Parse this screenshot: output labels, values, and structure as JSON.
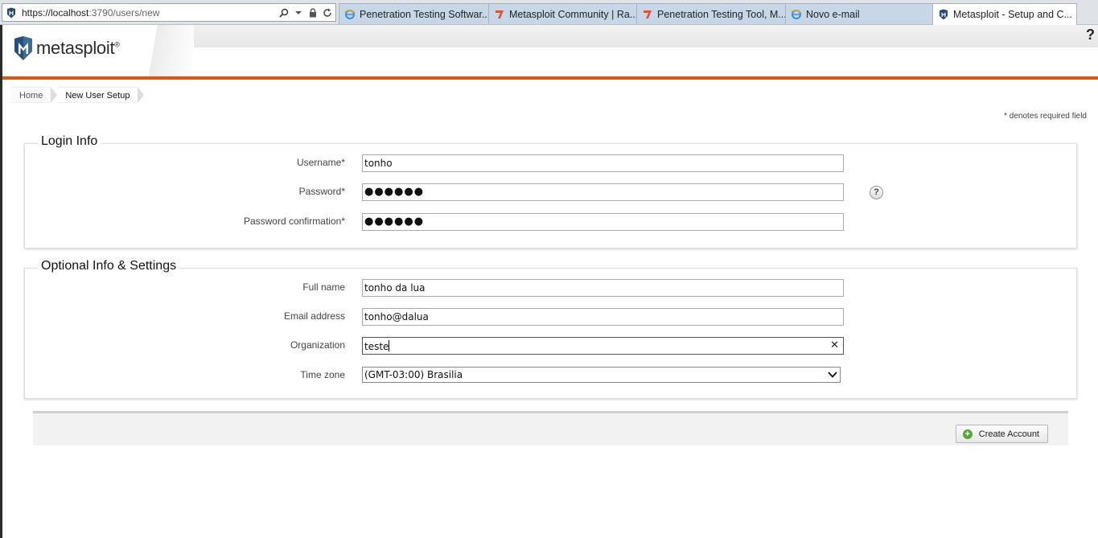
{
  "browser": {
    "url_prefix": "https://localhost",
    "url_rest": ":3790/users/new",
    "tabs": [
      {
        "label": "Penetration Testing Softwar...",
        "icon": "ie-icon",
        "active": false
      },
      {
        "label": "Metasploit Community | Ra...",
        "icon": "rapid7-icon",
        "active": false
      },
      {
        "label": "Penetration Testing Tool, M...",
        "icon": "rapid7-icon",
        "active": false
      },
      {
        "label": "Novo e-mail",
        "icon": "ie-icon",
        "active": false
      },
      {
        "label": "Metasploit - Setup and C...",
        "icon": "metasploit-icon",
        "active": true,
        "close": "×"
      }
    ]
  },
  "header": {
    "logo_text": "metasploit",
    "logo_mark": "®",
    "help": "?"
  },
  "breadcrumb": {
    "home": "Home",
    "current": "New User Setup"
  },
  "required_note": "* denotes required field",
  "login_info": {
    "title": "Login Info",
    "username_label": "Username*",
    "username_value": "tonho",
    "password_label": "Password*",
    "password_value": "●●●●●●",
    "password_help": "?",
    "password_confirm_label": "Password confirmation*",
    "password_confirm_value": "●●●●●●"
  },
  "optional_info": {
    "title": "Optional Info & Settings",
    "fullname_label": "Full name",
    "fullname_value": "tonho da lua",
    "email_label": "Email address",
    "email_value": "tonho@dalua",
    "org_label": "Organization",
    "org_value": "teste",
    "org_clear": "✕",
    "timezone_label": "Time zone",
    "timezone_value": "(GMT-03:00) Brasilia"
  },
  "actions": {
    "create_account": "Create Account"
  },
  "colors": {
    "accent_orange": "#e0560f",
    "tab_bg": "#c7d7e8"
  }
}
